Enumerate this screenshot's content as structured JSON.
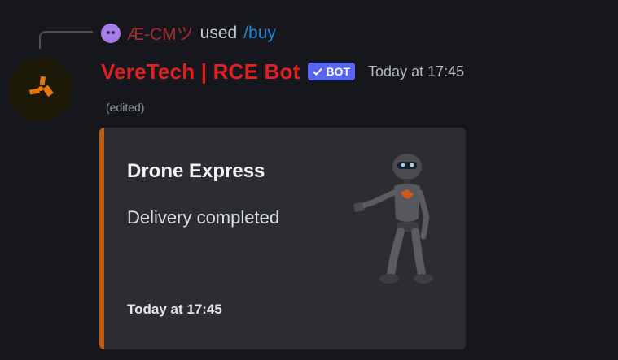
{
  "reply": {
    "user": "Æ-CMツ",
    "used": "used",
    "command": "/buy",
    "avatar_icon": "robot-face-icon"
  },
  "message": {
    "author": "VereTech | RCE Bot",
    "badge": "BOT",
    "timestamp": "Today at 17:45",
    "edited": "(edited)",
    "avatar_icon": "rust-logo-icon"
  },
  "embed": {
    "title": "Drone Express",
    "description": "Delivery completed",
    "footer": "Today at 17:45",
    "accent_color": "#c25b0e",
    "thumbnail_icon": "robot-thumbnail-icon"
  },
  "colors": {
    "bot_name": "#e0201f",
    "badge": "#5865f2",
    "command": "#1e88d8",
    "reply_user": "#a62a2a"
  }
}
